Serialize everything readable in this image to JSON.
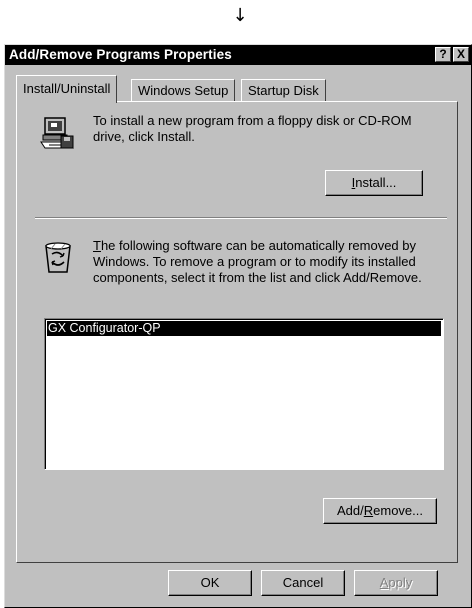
{
  "page": {
    "arrow": "↓"
  },
  "dialog": {
    "title": "Add/Remove Programs Properties",
    "help_label": "?",
    "close_label": "X"
  },
  "tabs": [
    {
      "label": "Install/Uninstall",
      "active": true
    },
    {
      "label": "Windows Setup",
      "active": false
    },
    {
      "label": "Startup Disk",
      "active": false
    }
  ],
  "install": {
    "icon": "floppy-computer-icon",
    "text": "To install a new program from a floppy disk or CD-ROM drive, click Install.",
    "button_prefix": "",
    "button_mnemonic": "I",
    "button_suffix": "nstall..."
  },
  "uninstall": {
    "icon": "recycle-bin-icon",
    "text_mnemonic": "T",
    "text_rest": "he following software can be automatically removed by Windows. To remove a program or to modify its installed components, select it from the list and click Add/Remove.",
    "items": [
      "GX Configurator-QP"
    ],
    "button_prefix": "Add/",
    "button_mnemonic": "R",
    "button_suffix": "emove..."
  },
  "footer": {
    "ok_label": "OK",
    "cancel_label": "Cancel",
    "apply_mnemonic": "A",
    "apply_rest": "pply"
  },
  "colors": {
    "face": "#c0c0c0",
    "titlebar": "#000000",
    "selection": "#000000"
  }
}
